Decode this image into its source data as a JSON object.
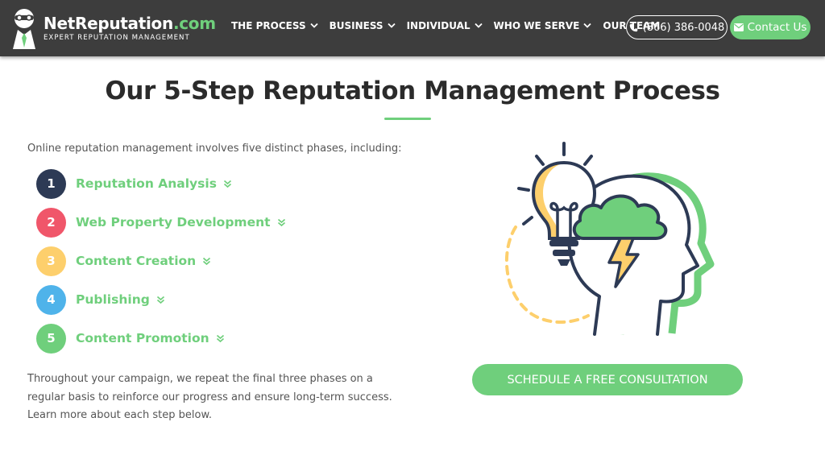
{
  "header": {
    "brand_name": "NetReputation",
    "brand_tld": ".com",
    "brand_tagline": "EXPERT REPUTATION MANAGEMENT",
    "nav": [
      {
        "label": "THE PROCESS",
        "has_dropdown": true
      },
      {
        "label": "BUSINESS",
        "has_dropdown": true
      },
      {
        "label": "INDIVIDUAL",
        "has_dropdown": true
      },
      {
        "label": "WHO WE SERVE",
        "has_dropdown": true
      },
      {
        "label": "OUR TEAM",
        "has_dropdown": false
      }
    ],
    "phone": "(866) 386-0048",
    "contact_label": "Contact Us"
  },
  "main": {
    "title": "Our 5-Step Reputation Management Process",
    "intro": "Online reputation management involves five distinct phases, including:",
    "steps": [
      {
        "number": "1",
        "label": "Reputation Analysis",
        "color": "#2d3a55"
      },
      {
        "number": "2",
        "label": "Web Property Development",
        "color": "#f0566a"
      },
      {
        "number": "3",
        "label": "Content Creation",
        "color": "#fdcf6c"
      },
      {
        "number": "4",
        "label": "Publishing",
        "color": "#4fb3ea"
      },
      {
        "number": "5",
        "label": "Content Promotion",
        "color": "#6fcf7c"
      }
    ],
    "outro": "Throughout your campaign, we repeat the final three phases on a regular basis to reinforce our progress and ensure long-term success. Learn more about each step below.",
    "cta_label": "SCHEDULE A FREE CONSULTATION"
  },
  "colors": {
    "nav_bg": "#3d3d3d",
    "accent_green": "#6fcf7c",
    "navy": "#2d3a55",
    "yellow": "#fdcf6c"
  },
  "icons": [
    "logo-mascot-icon",
    "chevron-down-icon",
    "phone-icon",
    "envelope-icon",
    "double-chevron-down-icon",
    "lightbulb-cloud-head-illustration"
  ]
}
